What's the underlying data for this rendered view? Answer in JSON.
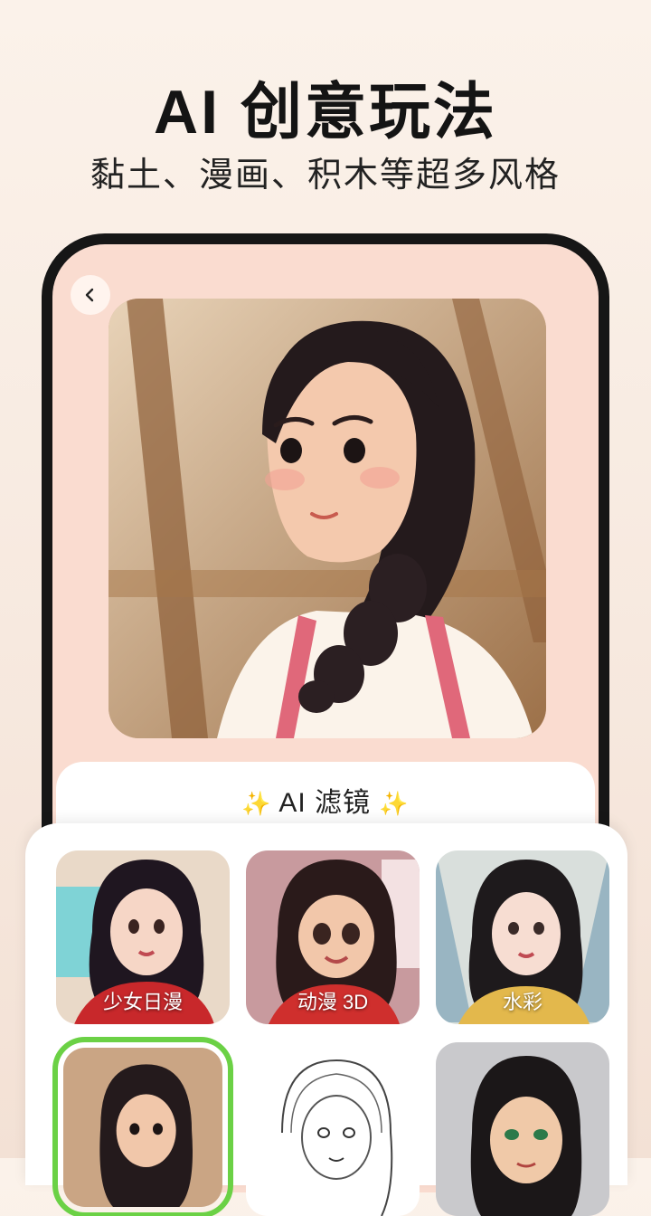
{
  "header": {
    "title": "AI 创意玩法",
    "subtitle": "黏土、漫画、积木等超多风格"
  },
  "preview": {
    "back_icon": "chevron-left-icon",
    "image": "clay-style-girl-portrait"
  },
  "filter_panel": {
    "title": "AI 滤镜",
    "sparkle_icon": "sparkle-icon"
  },
  "styles": [
    {
      "label": "少女日漫",
      "selected": false
    },
    {
      "label": "动漫 3D",
      "selected": false
    },
    {
      "label": "水彩",
      "selected": false
    },
    {
      "label": "",
      "selected": true
    },
    {
      "label": "",
      "selected": false
    },
    {
      "label": "",
      "selected": false
    }
  ],
  "colors": {
    "accent_green": "#6bd145",
    "panel_pink": "#fadcd0",
    "sparkle_yellow": "#f3b21b"
  }
}
